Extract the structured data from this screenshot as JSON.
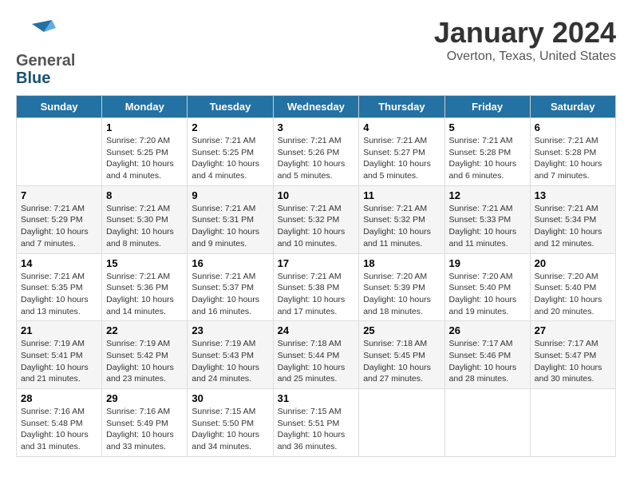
{
  "logo": {
    "general": "General",
    "blue": "Blue"
  },
  "title": "January 2024",
  "subtitle": "Overton, Texas, United States",
  "headers": [
    "Sunday",
    "Monday",
    "Tuesday",
    "Wednesday",
    "Thursday",
    "Friday",
    "Saturday"
  ],
  "weeks": [
    [
      {
        "num": "",
        "info": ""
      },
      {
        "num": "1",
        "info": "Sunrise: 7:20 AM\nSunset: 5:25 PM\nDaylight: 10 hours\nand 4 minutes."
      },
      {
        "num": "2",
        "info": "Sunrise: 7:21 AM\nSunset: 5:25 PM\nDaylight: 10 hours\nand 4 minutes."
      },
      {
        "num": "3",
        "info": "Sunrise: 7:21 AM\nSunset: 5:26 PM\nDaylight: 10 hours\nand 5 minutes."
      },
      {
        "num": "4",
        "info": "Sunrise: 7:21 AM\nSunset: 5:27 PM\nDaylight: 10 hours\nand 5 minutes."
      },
      {
        "num": "5",
        "info": "Sunrise: 7:21 AM\nSunset: 5:28 PM\nDaylight: 10 hours\nand 6 minutes."
      },
      {
        "num": "6",
        "info": "Sunrise: 7:21 AM\nSunset: 5:28 PM\nDaylight: 10 hours\nand 7 minutes."
      }
    ],
    [
      {
        "num": "7",
        "info": "Sunrise: 7:21 AM\nSunset: 5:29 PM\nDaylight: 10 hours\nand 7 minutes."
      },
      {
        "num": "8",
        "info": "Sunrise: 7:21 AM\nSunset: 5:30 PM\nDaylight: 10 hours\nand 8 minutes."
      },
      {
        "num": "9",
        "info": "Sunrise: 7:21 AM\nSunset: 5:31 PM\nDaylight: 10 hours\nand 9 minutes."
      },
      {
        "num": "10",
        "info": "Sunrise: 7:21 AM\nSunset: 5:32 PM\nDaylight: 10 hours\nand 10 minutes."
      },
      {
        "num": "11",
        "info": "Sunrise: 7:21 AM\nSunset: 5:32 PM\nDaylight: 10 hours\nand 11 minutes."
      },
      {
        "num": "12",
        "info": "Sunrise: 7:21 AM\nSunset: 5:33 PM\nDaylight: 10 hours\nand 11 minutes."
      },
      {
        "num": "13",
        "info": "Sunrise: 7:21 AM\nSunset: 5:34 PM\nDaylight: 10 hours\nand 12 minutes."
      }
    ],
    [
      {
        "num": "14",
        "info": "Sunrise: 7:21 AM\nSunset: 5:35 PM\nDaylight: 10 hours\nand 13 minutes."
      },
      {
        "num": "15",
        "info": "Sunrise: 7:21 AM\nSunset: 5:36 PM\nDaylight: 10 hours\nand 14 minutes."
      },
      {
        "num": "16",
        "info": "Sunrise: 7:21 AM\nSunset: 5:37 PM\nDaylight: 10 hours\nand 16 minutes."
      },
      {
        "num": "17",
        "info": "Sunrise: 7:21 AM\nSunset: 5:38 PM\nDaylight: 10 hours\nand 17 minutes."
      },
      {
        "num": "18",
        "info": "Sunrise: 7:20 AM\nSunset: 5:39 PM\nDaylight: 10 hours\nand 18 minutes."
      },
      {
        "num": "19",
        "info": "Sunrise: 7:20 AM\nSunset: 5:40 PM\nDaylight: 10 hours\nand 19 minutes."
      },
      {
        "num": "20",
        "info": "Sunrise: 7:20 AM\nSunset: 5:40 PM\nDaylight: 10 hours\nand 20 minutes."
      }
    ],
    [
      {
        "num": "21",
        "info": "Sunrise: 7:19 AM\nSunset: 5:41 PM\nDaylight: 10 hours\nand 21 minutes."
      },
      {
        "num": "22",
        "info": "Sunrise: 7:19 AM\nSunset: 5:42 PM\nDaylight: 10 hours\nand 23 minutes."
      },
      {
        "num": "23",
        "info": "Sunrise: 7:19 AM\nSunset: 5:43 PM\nDaylight: 10 hours\nand 24 minutes."
      },
      {
        "num": "24",
        "info": "Sunrise: 7:18 AM\nSunset: 5:44 PM\nDaylight: 10 hours\nand 25 minutes."
      },
      {
        "num": "25",
        "info": "Sunrise: 7:18 AM\nSunset: 5:45 PM\nDaylight: 10 hours\nand 27 minutes."
      },
      {
        "num": "26",
        "info": "Sunrise: 7:17 AM\nSunset: 5:46 PM\nDaylight: 10 hours\nand 28 minutes."
      },
      {
        "num": "27",
        "info": "Sunrise: 7:17 AM\nSunset: 5:47 PM\nDaylight: 10 hours\nand 30 minutes."
      }
    ],
    [
      {
        "num": "28",
        "info": "Sunrise: 7:16 AM\nSunset: 5:48 PM\nDaylight: 10 hours\nand 31 minutes."
      },
      {
        "num": "29",
        "info": "Sunrise: 7:16 AM\nSunset: 5:49 PM\nDaylight: 10 hours\nand 33 minutes."
      },
      {
        "num": "30",
        "info": "Sunrise: 7:15 AM\nSunset: 5:50 PM\nDaylight: 10 hours\nand 34 minutes."
      },
      {
        "num": "31",
        "info": "Sunrise: 7:15 AM\nSunset: 5:51 PM\nDaylight: 10 hours\nand 36 minutes."
      },
      {
        "num": "",
        "info": ""
      },
      {
        "num": "",
        "info": ""
      },
      {
        "num": "",
        "info": ""
      }
    ]
  ]
}
